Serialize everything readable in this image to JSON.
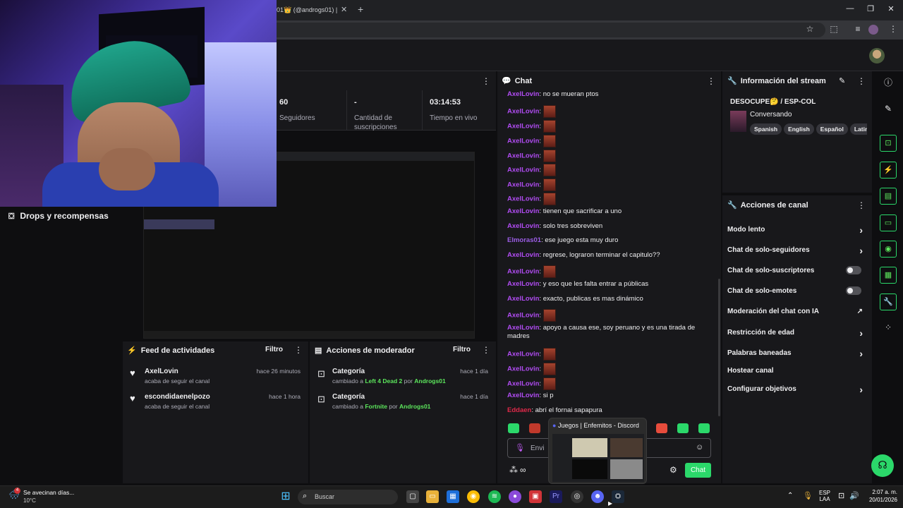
{
  "browser": {
    "tab_title": "01👑 (@androgs01) |"
  },
  "sidebar": {
    "drops_label": "Drops y recompensas"
  },
  "stats": [
    {
      "value": "60",
      "label": "Seguidores"
    },
    {
      "value": "-",
      "label": "Cantidad de suscripciones"
    },
    {
      "value": "03:14:53",
      "label": "Tiempo en vivo"
    }
  ],
  "activity_feed": {
    "title": "Feed de actividades",
    "filter_label": "Filtro",
    "items": [
      {
        "name": "AxelLovin",
        "desc": "acaba de seguir el canal",
        "time": "hace 26 minutos"
      },
      {
        "name": "escondidaenelpozo",
        "desc": "acaba de seguir el canal",
        "time": "hace 1 hora"
      }
    ]
  },
  "mod_actions": {
    "title": "Acciones de moderador",
    "filter_label": "Filtro",
    "items": [
      {
        "title": "Categoría",
        "prefix": "cambiado a",
        "game": "Left 4 Dead 2",
        "by": "por",
        "user": "Androgs01",
        "time": "hace 1 día"
      },
      {
        "title": "Categoría",
        "prefix": "cambiado a",
        "game": "Fortnite",
        "by": "por",
        "user": "Androgs01",
        "time": "hace 1 día"
      }
    ]
  },
  "chat": {
    "title": "Chat",
    "messages": [
      {
        "user": "AxelLovin",
        "text": "no se mueran ptos"
      },
      {
        "user": "AxelLovin",
        "text": ""
      },
      {
        "user": "AxelLovin",
        "text": ""
      },
      {
        "user": "AxelLovin",
        "text": ""
      },
      {
        "user": "AxelLovin",
        "text": ""
      },
      {
        "user": "AxelLovin",
        "text": ""
      },
      {
        "user": "AxelLovin",
        "text": ""
      },
      {
        "user": "AxelLovin",
        "text": ""
      },
      {
        "user": "AxelLovin",
        "text": "tienen que sacrificar a uno"
      },
      {
        "user": "AxelLovin",
        "text": "solo tres sobreviven"
      },
      {
        "user": "Elmoras01",
        "text": "ese juego esta muy duro"
      },
      {
        "user": "AxelLovin",
        "text": "regrese, lograron terminar el capitulo??"
      },
      {
        "user": "AxelLovin",
        "text": ""
      },
      {
        "user": "AxelLovin",
        "text": "y eso que les falta entrar a públicas"
      },
      {
        "user": "AxelLovin",
        "text": "exacto, publicas es mas dinámico"
      },
      {
        "user": "AxelLovin",
        "text": ""
      },
      {
        "user": "AxelLovin",
        "text": "apoyo a causa ese, soy peruano y es una tirada de madres"
      },
      {
        "user": "AxelLovin",
        "text": ""
      },
      {
        "user": "AxelLovin",
        "text": ""
      },
      {
        "user": "AxelLovin",
        "text": ""
      },
      {
        "user": "AxelLovin",
        "text": "si p"
      },
      {
        "user": "Eddaen",
        "text": "abrí el fornai sapapura"
      }
    ],
    "input_placeholder": "Envi",
    "send_label": "Chat"
  },
  "stream_info": {
    "title": "Información del stream",
    "stream_title": "DESOCUPE🤔 / ESP-COL",
    "category": "Conversando",
    "tags": [
      "Spanish",
      "English",
      "Español",
      "Latin"
    ]
  },
  "channel_actions": {
    "title": "Acciones de canal",
    "items": [
      {
        "label": "Modo lento",
        "control": "chevron"
      },
      {
        "label": "Chat de solo-seguidores",
        "control": "chevron"
      },
      {
        "label": "Chat de solo-suscriptores",
        "control": "toggle"
      },
      {
        "label": "Chat de solo-emotes",
        "control": "toggle"
      },
      {
        "label": "Moderación del chat con IA",
        "control": "external"
      },
      {
        "label": "Restricción de edad",
        "control": "chevron"
      },
      {
        "label": "Palabras baneadas",
        "control": "chevron"
      },
      {
        "label": "Hostear canal",
        "control": "none"
      },
      {
        "label": "Configurar objetivos",
        "control": "chevron"
      }
    ]
  },
  "discord_popup": {
    "title": "Juegos | Enfemitos - Discord"
  },
  "taskbar": {
    "weather_text": "Se avecinan días...",
    "temperature": "10°C",
    "weather_badge": "4",
    "search_label": "Buscar",
    "lang": "ESP",
    "lang_sub": "LAA",
    "time": "2:07 a. m.",
    "date": "20/01/2026"
  }
}
